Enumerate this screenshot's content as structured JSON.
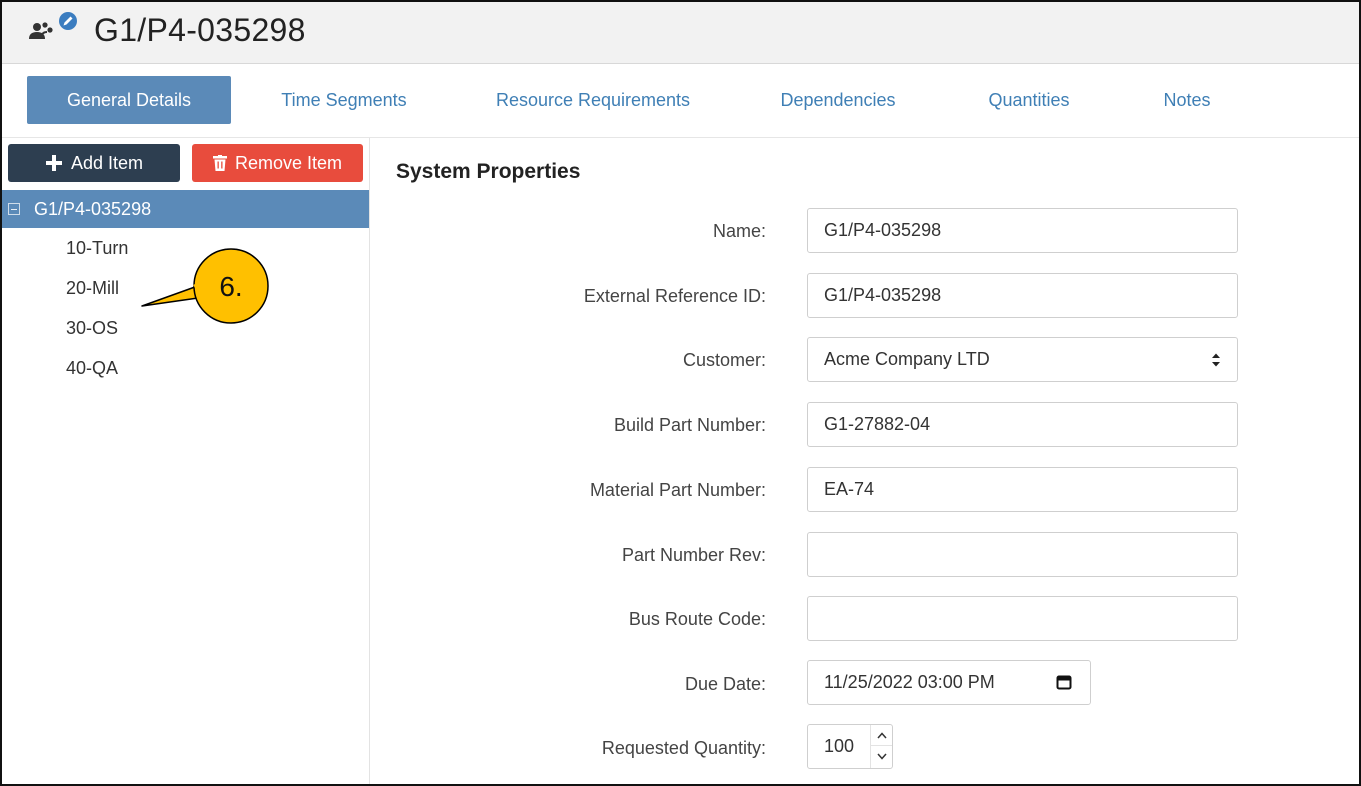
{
  "header": {
    "title": "G1/P4-035298",
    "icon": "edit-team-icon"
  },
  "tabs": [
    {
      "label": "General Details",
      "active": true
    },
    {
      "label": "Time Segments",
      "active": false
    },
    {
      "label": "Resource Requirements",
      "active": false
    },
    {
      "label": "Dependencies",
      "active": false
    },
    {
      "label": "Quantities",
      "active": false
    },
    {
      "label": "Notes",
      "active": false
    }
  ],
  "toolbar": {
    "add_label": "Add Item",
    "remove_label": "Remove Item"
  },
  "tree": {
    "root": "G1/P4-035298",
    "children": [
      "10-Turn",
      "20-Mill",
      "30-OS",
      "40-QA"
    ]
  },
  "callout": {
    "text": "6."
  },
  "form": {
    "section_title": "System Properties",
    "fields": {
      "name": {
        "label": "Name:",
        "value": "G1/P4-035298"
      },
      "external_ref": {
        "label": "External Reference ID:",
        "value": "G1/P4-035298"
      },
      "customer": {
        "label": "Customer:",
        "value": "Acme Company LTD"
      },
      "build_part": {
        "label": "Build Part Number:",
        "value": "G1-27882-04"
      },
      "material_part": {
        "label": "Material Part Number:",
        "value": "EA-74"
      },
      "part_rev": {
        "label": "Part Number Rev:",
        "value": ""
      },
      "bus_route": {
        "label": "Bus Route Code:",
        "value": ""
      },
      "due_date": {
        "label": "Due Date:",
        "value": "11/25/2022 03:00 PM"
      },
      "requested_qty": {
        "label": "Requested Quantity:",
        "value": "100"
      }
    }
  },
  "colors": {
    "accent": "#5b8ab8",
    "tab_link": "#3f7fb5",
    "add_button": "#2d3e50",
    "remove_button": "#e84c3d",
    "callout_fill": "#ffc000"
  }
}
